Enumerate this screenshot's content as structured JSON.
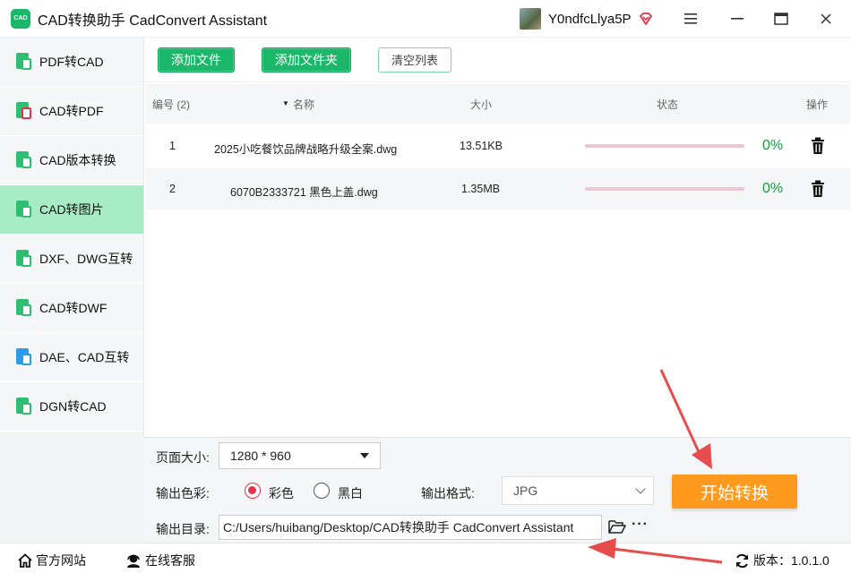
{
  "app": {
    "logo_text": "CAD",
    "title": "CAD转换助手 CadConvert Assistant",
    "username": "Y0ndfcLlya5P"
  },
  "sidebar": {
    "items": [
      {
        "label": "PDF转CAD",
        "active": false
      },
      {
        "label": "CAD转PDF",
        "active": false
      },
      {
        "label": "CAD版本转换",
        "active": false
      },
      {
        "label": "CAD转图片",
        "active": true
      },
      {
        "label": "DXF、DWG互转",
        "active": false
      },
      {
        "label": "CAD转DWF",
        "active": false
      },
      {
        "label": "DAE、CAD互转",
        "active": false
      },
      {
        "label": "DGN转CAD",
        "active": false
      }
    ]
  },
  "toolbar": {
    "add_file": "添加文件",
    "add_folder": "添加文件夹",
    "clear_list": "清空列表"
  },
  "table": {
    "headers": {
      "index": "编号 (2)",
      "name": "名称",
      "size": "大小",
      "status": "状态",
      "action": "操作"
    },
    "rows": [
      {
        "index": "1",
        "name": "2025小吃餐饮品牌战略升级全案.dwg",
        "size": "13.51KB",
        "progress": 0,
        "percent": "0%"
      },
      {
        "index": "2",
        "name": "6070B2333721 黑色上盖.dwg",
        "size": "1.35MB",
        "progress": 0,
        "percent": "0%"
      }
    ]
  },
  "settings": {
    "page_size_label": "页面大小:",
    "page_size_value": "1280 * 960",
    "color_label": "输出色彩:",
    "color_options": [
      "彩色",
      "黑白"
    ],
    "color_selected": "彩色",
    "format_label": "输出格式:",
    "format_value": "JPG",
    "output_dir_label": "输出目录:",
    "output_dir_value": "C:/Users/huibang/Desktop/CAD转换助手 CadConvert Assistant",
    "more": "···",
    "start_button": "开始转换"
  },
  "statusbar": {
    "website": "官方网站",
    "support": "在线客服",
    "version": "版本：1.0.1.0"
  },
  "colors": {
    "brand_green": "#1cb86a",
    "active_sidebar": "#a8ecc6",
    "start_orange": "#ff9a1f",
    "annotation_red": "#e84c4c",
    "percent_green": "#1a9b43"
  }
}
